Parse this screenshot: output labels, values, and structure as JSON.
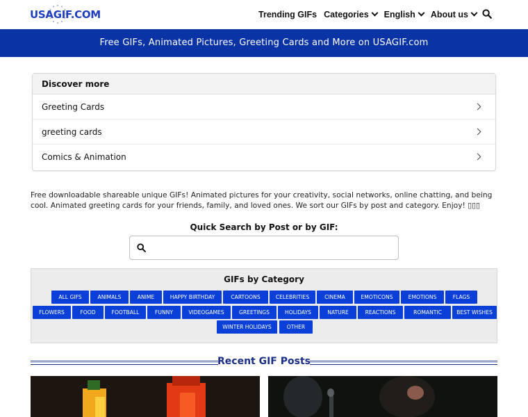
{
  "header": {
    "logo_text": "USAGIF.COM",
    "nav": [
      {
        "label": "Trending GIFs",
        "dropdown": false
      },
      {
        "label": "Categories",
        "dropdown": true
      },
      {
        "label": "English",
        "dropdown": true
      },
      {
        "label": "About us",
        "dropdown": true
      }
    ]
  },
  "banner": {
    "text": "Free GIFs, Animated Pictures, Greeting Cards and More on USAGIF.com"
  },
  "discover": {
    "title": "Discover more",
    "items": [
      "Greeting Cards",
      "greeting cards",
      "Comics & Animation"
    ]
  },
  "intro": {
    "text": "Free downloadable shareable unique GIFs! Animated pictures for your creativity, social networks, online chatting, and being cool. Animated greeting cards for your friends, family, and loved ones. We sort our GIFs by post and category. Enjoy! ▯▯▯"
  },
  "quick_search": {
    "label": "Quick Search by Post or by GIF:",
    "placeholder": ""
  },
  "categories": {
    "title": "GIFs by Category",
    "rows": [
      [
        "ALL GIFS",
        "ANIMALS",
        "ANIME",
        "HAPPY BIRTHDAY",
        "CARTOONS",
        "CELEBRITIES",
        "CINEMA",
        "EMOTICONS",
        "EMOTIONS",
        "FLAGS"
      ],
      [
        "FLOWERS",
        "FOOD",
        "FOOTBALL",
        "FUNNY",
        "VIDEOGAMES",
        "GREETINGS",
        "HOLIDAYS",
        "NATURE",
        "REACTIONS",
        "ROMANTIC",
        "BEST WISHES"
      ],
      [
        "WINTER HOLIDAYS",
        "OTHER"
      ]
    ]
  },
  "recent": {
    "title": "Recent GIF Posts"
  },
  "colors": {
    "brand": "#0a33a6",
    "button": "#0a3fd8",
    "heading": "#1a2f86"
  }
}
